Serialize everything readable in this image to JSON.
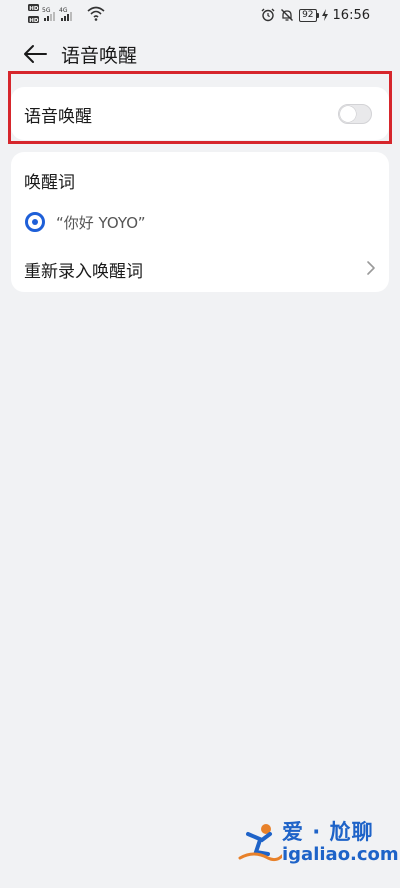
{
  "status_bar": {
    "time": "16:56",
    "battery": "92",
    "left_icons": [
      "hd-icon",
      "hd-icon",
      "5g-signal-icon",
      "4g-signal-icon",
      "wifi-icon"
    ],
    "right_icons": [
      "alarm-icon",
      "mute-icon",
      "battery-icon"
    ]
  },
  "header": {
    "title": "语音唤醒",
    "back_icon": "arrow-left-icon"
  },
  "voice_wakeup": {
    "label": "语音唤醒",
    "enabled": false
  },
  "wake_word_section": {
    "title": "唤醒词",
    "option_text": "“你好 YOYO”",
    "option_selected": true,
    "rerecord_label": "重新录入唤醒词"
  },
  "watermark": {
    "title": "爱 · 尬聊",
    "url": "igaliao.com"
  },
  "colors": {
    "background": "#f1f2f4",
    "card": "#ffffff",
    "accent": "#1e5fd8",
    "highlight_border": "#d6262c",
    "watermark": "#1e63c8"
  }
}
